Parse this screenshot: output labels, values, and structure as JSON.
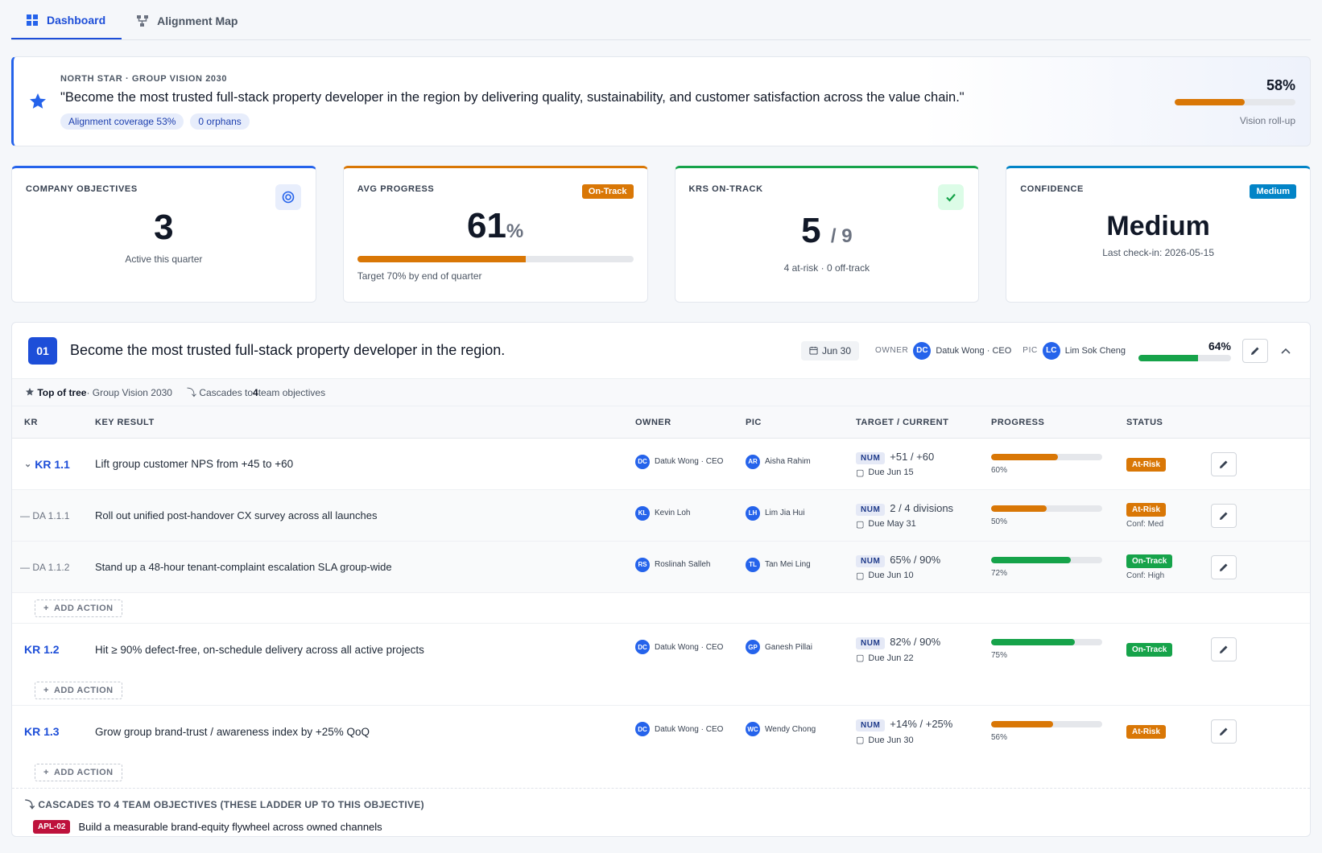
{
  "tabs": [
    {
      "label": "Dashboard",
      "active": true,
      "icon": "grid-icon"
    },
    {
      "label": "Alignment Map",
      "active": false,
      "icon": "hierarchy-icon"
    }
  ],
  "northstar": {
    "eyebrow": "NORTH STAR · GROUP VISION 2030",
    "quote": "\"Become the most trusted full-stack property developer in the region by delivering quality, sustainability, and customer satisfaction across the value chain.\"",
    "chips": [
      "Alignment coverage 53%",
      "0 orphans"
    ],
    "pct_label": "58%",
    "progress": 58,
    "sub": "Vision roll-up"
  },
  "kpis": {
    "objectives": {
      "label": "COMPANY OBJECTIVES",
      "value": "3",
      "sub": "Active this quarter"
    },
    "avg": {
      "label": "AVG PROGRESS",
      "badge": "On-Track",
      "value": "61",
      "unit": "%",
      "progress": 61,
      "sub": "Target 70% by end of quarter"
    },
    "krs": {
      "label": "KRS ON-TRACK",
      "value": "5",
      "unit": "/ 9",
      "sub": "4 at-risk · 0 off-track"
    },
    "confidence": {
      "label": "CONFIDENCE",
      "badge": "Medium",
      "value": "Medium",
      "sub": "Last check-in: 2026-05-15"
    }
  },
  "objective": {
    "num": "01",
    "title": "Become the most trusted full-stack property developer in the region.",
    "date": "Jun 30",
    "owner_tag": "OWNER",
    "owner_initials": "DC",
    "owner": "Datuk Wong · CEO",
    "pic_tag": "PIC",
    "pic_initials": "LC",
    "pic": "Lim Sok Cheng",
    "pct_label": "64%",
    "progress": 64,
    "top_label": "Top of tree",
    "top_rest": "· Group Vision 2030",
    "cascades_pre": "Cascades to",
    "cascades_num": "4",
    "cascades_post": "team objectives"
  },
  "table": {
    "headers": {
      "kr": "KR",
      "result": "KEY RESULT",
      "owner": "OWNER",
      "pic": "PIC",
      "target": "TARGET / CURRENT",
      "progress": "PROGRESS",
      "status": "STATUS"
    },
    "add_label": "ADD ACTION",
    "num_tag": "NUM",
    "kr11": {
      "code": "KR 1.1",
      "result": "Lift group customer NPS from +45 to +60",
      "owner_i": "DC",
      "owner": "Datuk Wong · CEO",
      "pic_i": "AR",
      "pic": "Aisha Rahim",
      "target": "+51 / +60",
      "due": "Due Jun 15",
      "pct": "60%",
      "progress": 60,
      "status": "At-Risk"
    },
    "da111": {
      "code": "— DA 1.1.1",
      "result": "Roll out unified post-handover CX survey across all launches",
      "owner_i": "KL",
      "owner": "Kevin Loh",
      "pic_i": "LH",
      "pic": "Lim Jia Hui",
      "target": "2 / 4 divisions",
      "due": "Due May 31",
      "pct": "50%",
      "progress": 50,
      "status": "At-Risk",
      "conf": "Conf: Med"
    },
    "da112": {
      "code": "— DA 1.1.2",
      "result": "Stand up a 48-hour tenant-complaint escalation SLA group-wide",
      "owner_i": "RS",
      "owner": "Roslinah Salleh",
      "pic_i": "TL",
      "pic": "Tan Mei Ling",
      "target": "65% / 90%",
      "due": "Due Jun 10",
      "pct": "72%",
      "progress": 72,
      "status": "On-Track",
      "conf": "Conf: High"
    },
    "kr12": {
      "code": "KR 1.2",
      "result": "Hit ≥ 90% defect-free, on-schedule delivery across all active projects",
      "owner_i": "DC",
      "owner": "Datuk Wong · CEO",
      "pic_i": "GP",
      "pic": "Ganesh Pillai",
      "target": "82% / 90%",
      "due": "Due Jun 22",
      "pct": "75%",
      "progress": 75,
      "status": "On-Track"
    },
    "kr13": {
      "code": "KR 1.3",
      "result": "Grow group brand-trust / awareness index by +25% QoQ",
      "owner_i": "DC",
      "owner": "Datuk Wong · CEO",
      "pic_i": "WC",
      "pic": "Wendy Chong",
      "target": "+14% / +25%",
      "due": "Due Jun 30",
      "pct": "56%",
      "progress": 56,
      "status": "At-Risk"
    }
  },
  "cascade": {
    "title": "CASCADES TO 4 TEAM OBJECTIVES (THESE LADDER UP TO THIS OBJECTIVE)",
    "first_tag": "APL-02",
    "first_title": "Build a measurable brand-equity flywheel across owned channels"
  },
  "colors": {
    "accent": "#1d4ed8",
    "at_risk": "#d97706",
    "on_track": "#16a34a",
    "medium": "#0284c7"
  }
}
